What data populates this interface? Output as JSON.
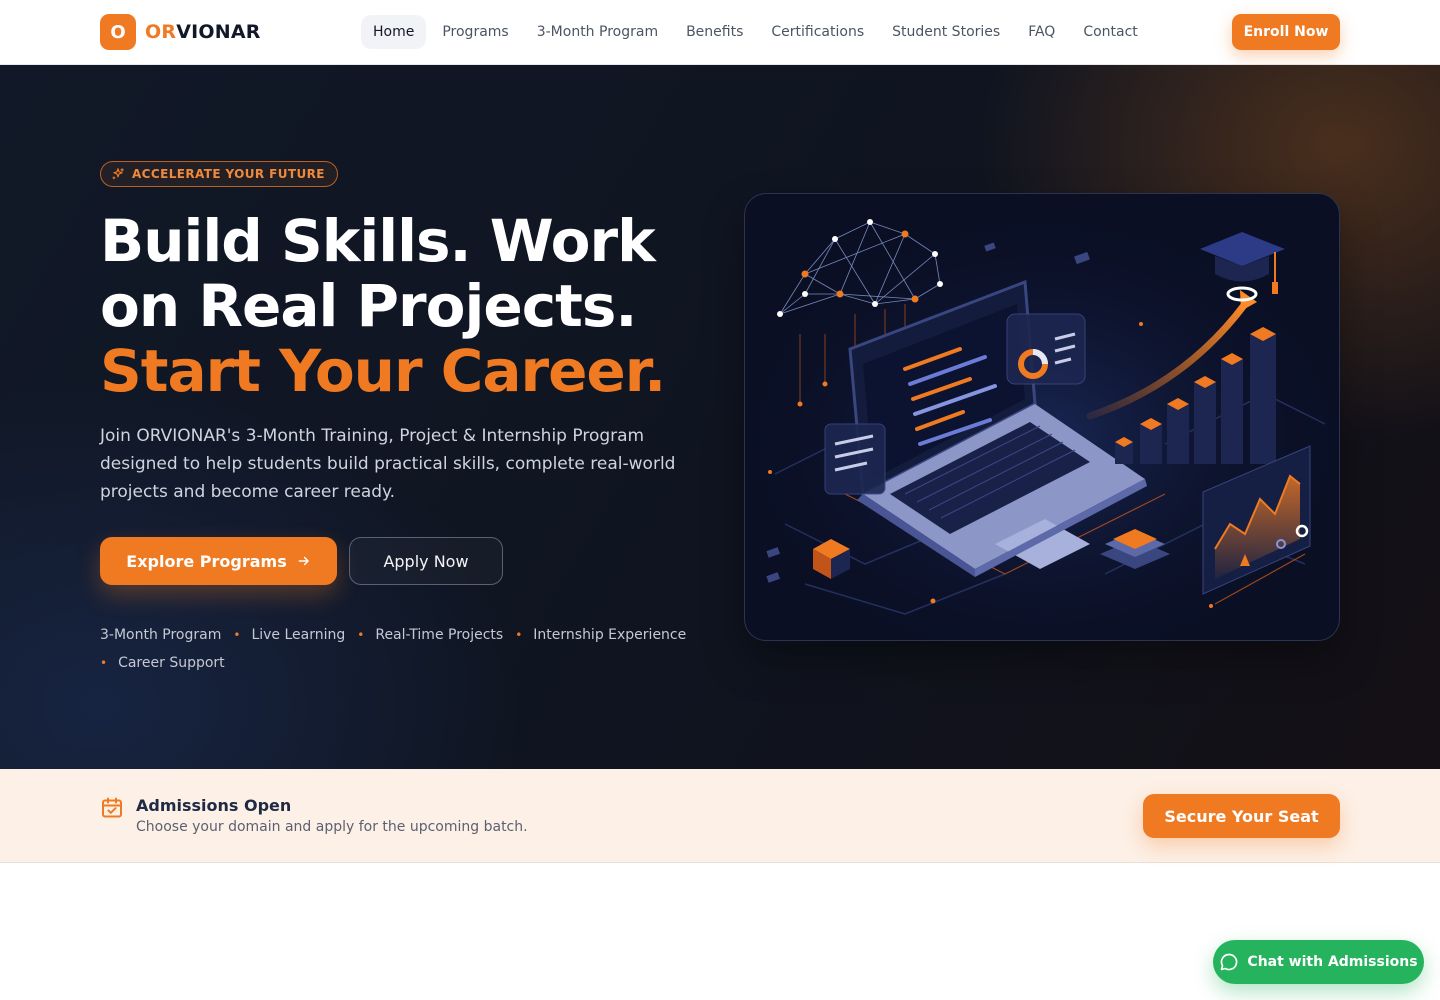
{
  "brand": {
    "mark": "O",
    "name_accent": "OR",
    "name_rest": "VIONAR"
  },
  "nav": {
    "items": [
      "Home",
      "Programs",
      "3-Month Program",
      "Benefits",
      "Certifications",
      "Student Stories",
      "FAQ",
      "Contact"
    ],
    "active": "Home",
    "cta": "Enroll Now"
  },
  "hero": {
    "badge": "ACCELERATE YOUR FUTURE",
    "headline_white": "Build Skills. Work on Real Projects. ",
    "headline_accent": "Start Your Career.",
    "subtitle": "Join ORVIONAR's 3-Month Training, Project & Internship Program designed to help students build practical skills, complete real-world projects and become career ready.",
    "primary_cta": "Explore Programs",
    "secondary_cta": "Apply Now",
    "features": [
      "3-Month Program",
      "Live Learning",
      "Real-Time Projects",
      "Internship Experience",
      "Career Support"
    ]
  },
  "admissions": {
    "title": "Admissions Open",
    "subtitle": "Choose your domain and apply for the upcoming batch.",
    "cta": "Secure Your Seat"
  },
  "chat": {
    "label": "Chat with Admissions"
  },
  "colors": {
    "accent": "#ef7a22",
    "dark": "#111827",
    "chat": "#25b35d",
    "banner": "#fdf0e6"
  },
  "icons": [
    "sparkle-icon",
    "arrow-right-icon",
    "calendar-check-icon",
    "chat-bubble-icon"
  ]
}
